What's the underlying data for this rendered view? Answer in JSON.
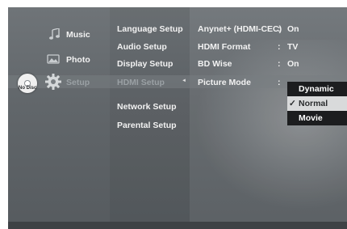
{
  "categories": [
    {
      "label": "Music",
      "icon": "music-note-icon"
    },
    {
      "label": "Photo",
      "icon": "photo-icon"
    },
    {
      "label": "Setup",
      "icon": "gear-icon"
    }
  ],
  "disc_status": "No Disc",
  "setup_menu": [
    "Language Setup",
    "Audio Setup",
    "Display Setup",
    "HDMI Setup",
    "Network Setup",
    "Parental Setup"
  ],
  "hdmi_settings": [
    {
      "label": "Anynet+ (HDMI-CEC)",
      "value": "On"
    },
    {
      "label": "HDMI Format",
      "value": "TV"
    },
    {
      "label": "BD Wise",
      "value": "On"
    },
    {
      "label": "Picture Mode",
      "value": ""
    }
  ],
  "separator": ":",
  "picture_mode_options": [
    {
      "label": "Dynamic",
      "selected": false
    },
    {
      "label": "Normal",
      "selected": true
    },
    {
      "label": "Movie",
      "selected": false
    }
  ],
  "check_mark": "✓",
  "highlight_marker": "◄"
}
